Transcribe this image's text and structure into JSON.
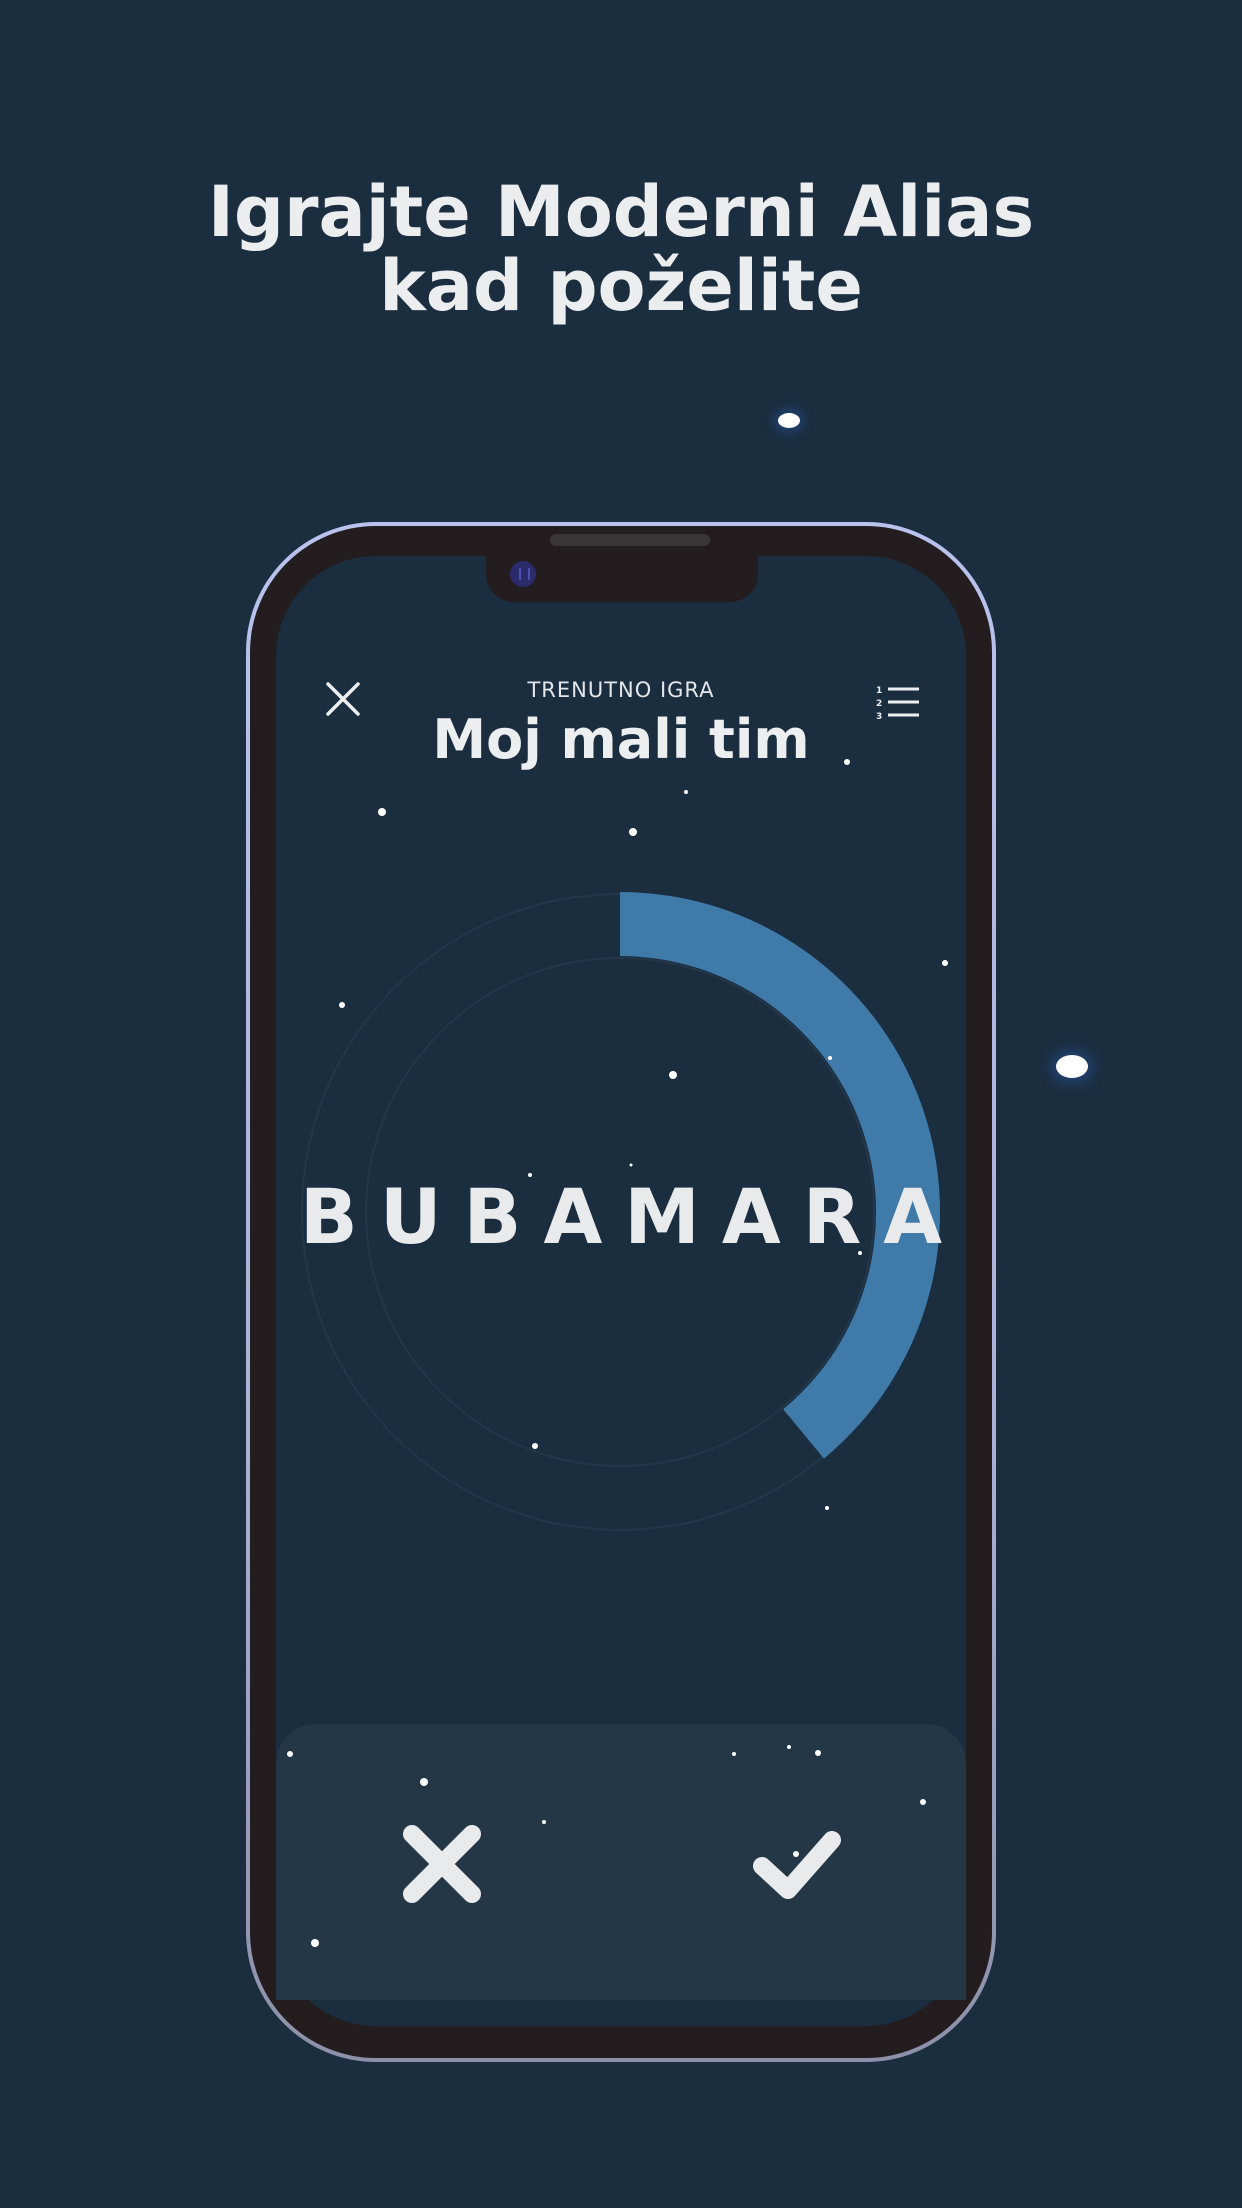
{
  "promo": {
    "headline_line1": "Igrajte Moderni Alias",
    "headline_line2": "kad poželite"
  },
  "game": {
    "caption": "TRENUTNO IGRA",
    "team_name": "Moj mali tim",
    "current_word": "BUBAMARA",
    "timer_remaining_fraction": 0.39
  },
  "icons": {
    "close": "close-icon",
    "leaderboard": "ranked-list-icon",
    "wrong": "cross-icon",
    "correct": "checkmark-icon"
  },
  "colors": {
    "background": "#1b2e40",
    "panel": "#243746",
    "timer_arc": "#3f7aa9",
    "text": "#ecedef",
    "phone_frame": "#231d1f"
  }
}
